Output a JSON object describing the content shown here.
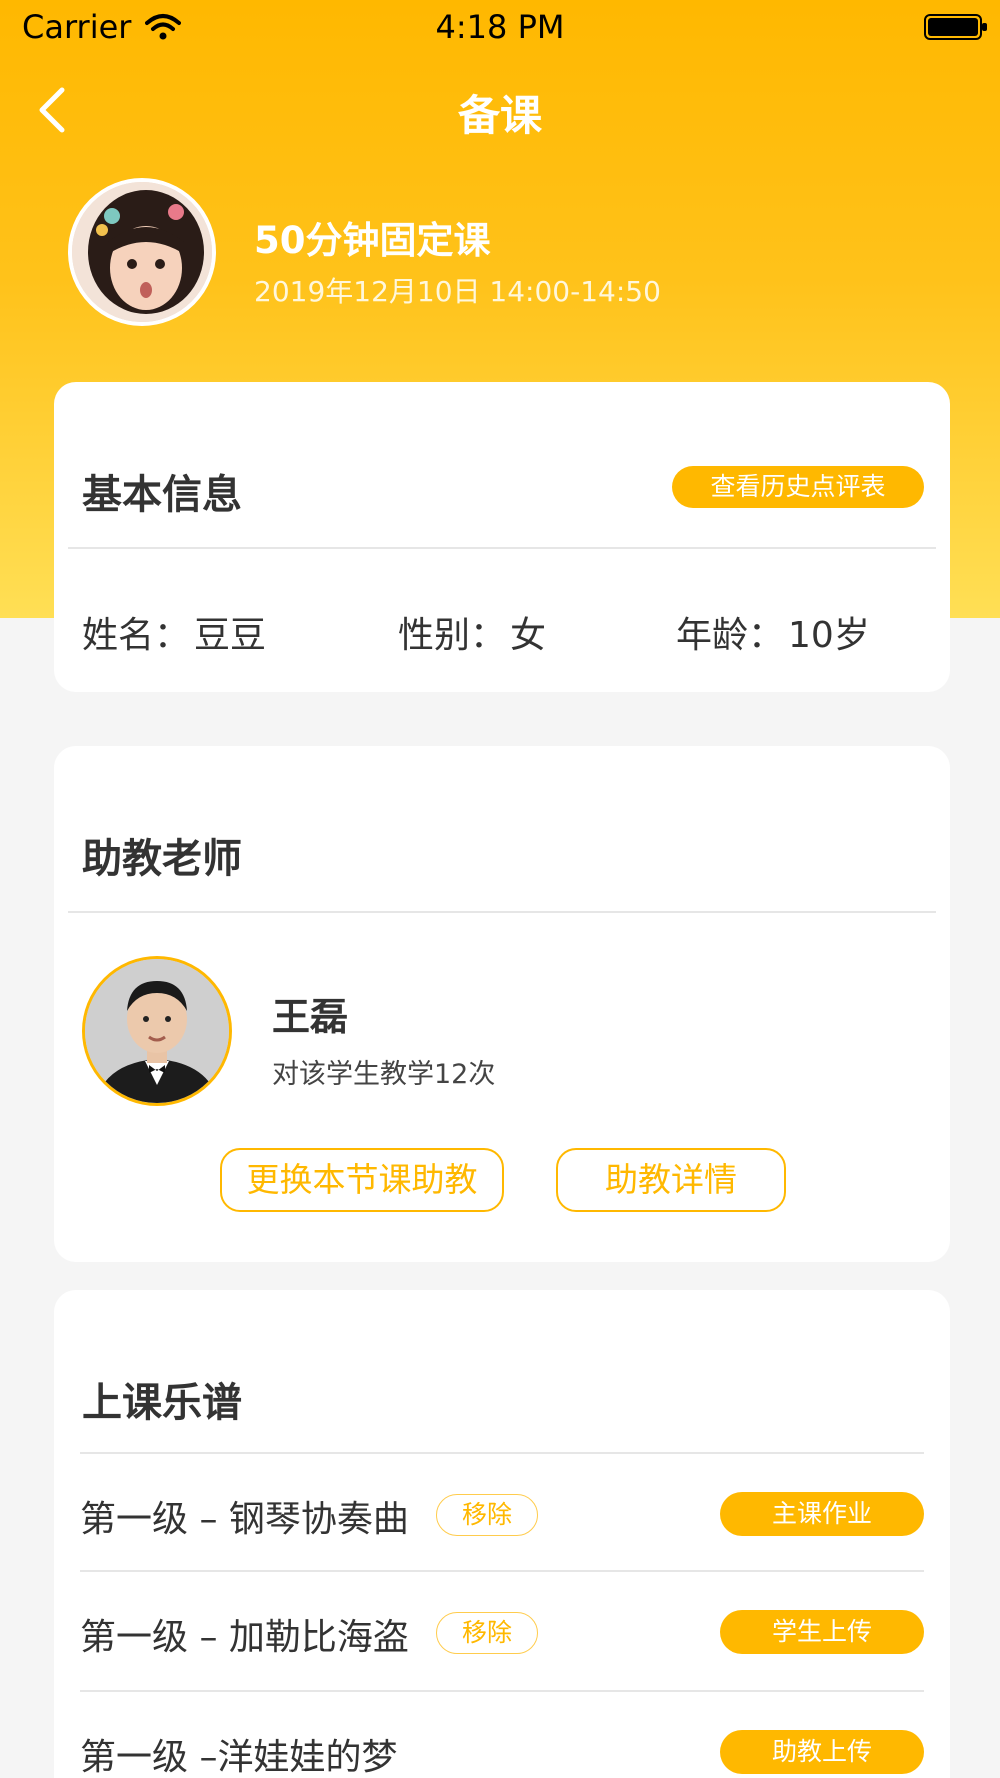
{
  "status_bar": {
    "carrier": "Carrier",
    "time": "4:18 PM",
    "icons": [
      "wifi-icon",
      "battery-icon"
    ]
  },
  "nav": {
    "title": "备课",
    "back_icon": "chevron-left-icon"
  },
  "lesson": {
    "title": "50分钟固定课",
    "time": "2019年12月10日 14:00-14:50"
  },
  "basic_info": {
    "title": "基本信息",
    "history_button": "查看历史点评表",
    "name_label": "姓名：",
    "name_value": "豆豆",
    "gender_label": "性别：",
    "gender_value": "女",
    "age_label": "年龄：",
    "age_value": "10岁"
  },
  "assistant": {
    "title": "助教老师",
    "name": "王磊",
    "count_text": "对该学生教学12次",
    "change_button": "更换本节课助教",
    "detail_button": "助教详情"
  },
  "scores": {
    "title": "上课乐谱",
    "remove_label": "移除",
    "items": [
      {
        "name": "第一级 – 钢琴协奏曲",
        "button": "主课作业",
        "removable": true
      },
      {
        "name": "第一级 – 加勒比海盗",
        "button": "学生上传",
        "removable": true
      },
      {
        "name": "第一级 –洋娃娃的梦",
        "button": "助教上传",
        "removable": false
      }
    ]
  },
  "colors": {
    "accent": "#ffb800",
    "header_top": "#ffb800",
    "header_bottom": "#ffdf55",
    "background": "#f5f5f5",
    "card": "#ffffff",
    "text": "#333333"
  }
}
